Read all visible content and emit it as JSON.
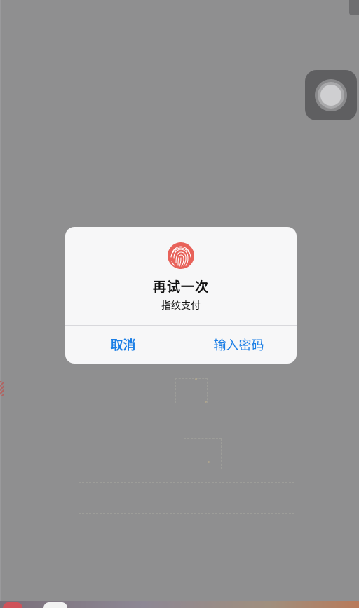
{
  "dialog": {
    "title": "再试一次",
    "message": "指纹支付",
    "cancel_label": "取消",
    "password_label": "输入密码",
    "icon": "fingerprint-icon",
    "accent_color": "#1a7ee6",
    "icon_color": "#e8625a"
  },
  "assistive_touch": {
    "icon": "assistive-touch-icon"
  }
}
